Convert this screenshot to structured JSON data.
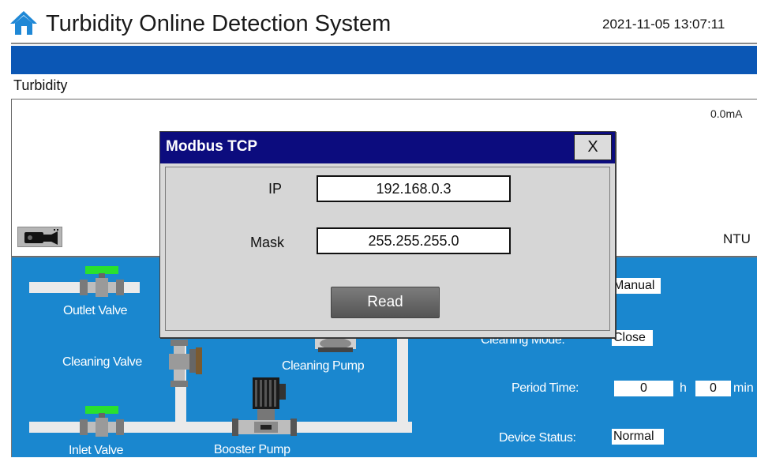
{
  "header": {
    "title": "Turbidity Online Detection System",
    "datetime": "2021-11-05 13:07:11",
    "home_icon": "home-icon"
  },
  "chart_panel": {
    "label": "Turbidity",
    "current_value": "0.0mA",
    "unit": "NTU",
    "camera_icon": "camera-icon"
  },
  "process": {
    "outlet_valve": "Outlet Valve",
    "cleaning_valve": "Cleaning Valve",
    "cleaning_pump": "Cleaning Pump",
    "inlet_valve": "Inlet Valve",
    "booster_pump": "Booster Pump",
    "mode_value": "Manual",
    "cleaning_mode_label": "Cleaning Mode:",
    "cleaning_mode_value": "Close",
    "period_time_label": "Period Time:",
    "period_hours": "0",
    "hours_unit": "h",
    "period_minutes": "0",
    "minutes_unit": "min",
    "device_status_label": "Device Status:",
    "device_status_value": "Normal"
  },
  "dialog": {
    "title": "Modbus TCP",
    "close_label": "X",
    "ip_label": "IP",
    "ip_value": "192.168.0.3",
    "mask_label": "Mask",
    "mask_value": "255.255.255.0",
    "read_label": "Read"
  },
  "colors": {
    "title_bar_blue": "#0b57b5",
    "process_blue": "#1a87cf",
    "dialog_title_navy": "#0c0c7e",
    "valve_open_green": "#29e02e"
  }
}
